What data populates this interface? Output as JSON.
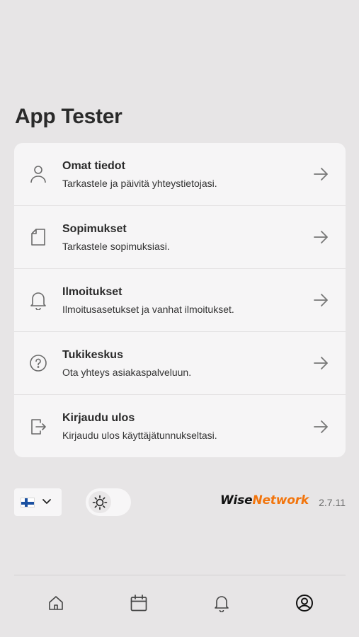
{
  "app": {
    "title": "App Tester"
  },
  "menu": [
    {
      "icon": "user-icon",
      "title": "Omat tiedot",
      "description": "Tarkastele ja päivitä yhteystietojasi."
    },
    {
      "icon": "document-icon",
      "title": "Sopimukset",
      "description": "Tarkastele sopimuksiasi."
    },
    {
      "icon": "bell-icon",
      "title": "Ilmoitukset",
      "description": "Ilmoitusasetukset ja vanhat ilmoitukset."
    },
    {
      "icon": "help-circle-icon",
      "title": "Tukikeskus",
      "description": "Ota yhteys asiakaspalveluun."
    },
    {
      "icon": "logout-icon",
      "title": "Kirjaudu ulos",
      "description": "Kirjaudu ulos käyttäjätunnukseltasi."
    }
  ],
  "footer": {
    "language": {
      "selected": "fi",
      "flag": "finland-flag-icon"
    },
    "theme": {
      "icon": "sun-icon",
      "mode": "light"
    },
    "brand": {
      "part1": "Wise",
      "part2": "Network",
      "color1": "#111111",
      "color2": "#f2750d"
    },
    "version": "2.7.11"
  },
  "tabs": [
    {
      "icon": "home-icon",
      "active": false
    },
    {
      "icon": "calendar-icon",
      "active": false
    },
    {
      "icon": "bell-icon",
      "active": false
    },
    {
      "icon": "profile-circle-icon",
      "active": true
    }
  ]
}
